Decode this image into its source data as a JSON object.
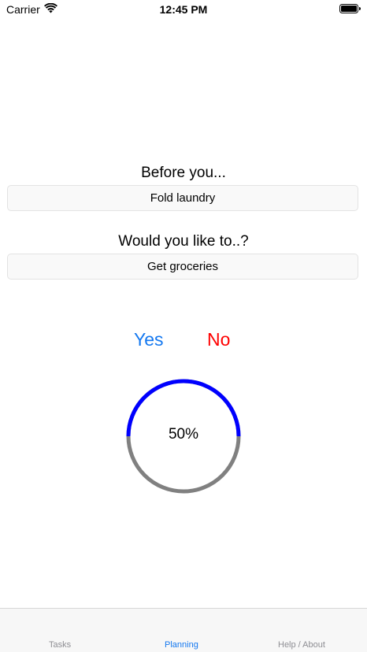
{
  "status_bar": {
    "carrier": "Carrier",
    "time": "12:45 PM",
    "wifi_icon": "wifi-icon",
    "battery_icon": "battery-icon"
  },
  "prompt": {
    "before_label": "Before you...",
    "before_value": "Fold laundry",
    "would_label": "Would you like to..?",
    "would_value": "Get groceries"
  },
  "actions": {
    "yes_label": "Yes",
    "no_label": "No"
  },
  "progress": {
    "value": 0.5,
    "label": "50%"
  },
  "tabs": [
    {
      "label": "Tasks"
    },
    {
      "label": "Planning"
    },
    {
      "label": "Help / About"
    }
  ],
  "colors": {
    "yes": "#1478f0",
    "no": "#ff0000",
    "progress_fill": "#0000ff",
    "progress_track": "#808080",
    "tab_active": "#1478f0",
    "tab_inactive": "#8e8e93"
  }
}
